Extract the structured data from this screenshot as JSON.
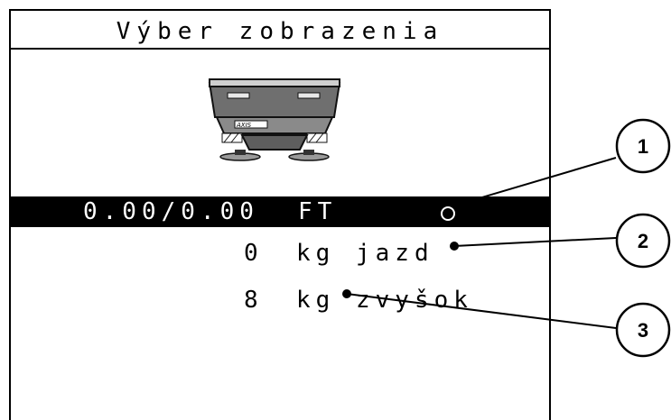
{
  "screen": {
    "title": "Výber zobrazenia",
    "device_icon": "spreader-machine-icon",
    "device_badge": "AXIS"
  },
  "rows": [
    {
      "value": "0.00/0.00",
      "unit": "FT",
      "selected": true
    },
    {
      "value": "0",
      "unit": "kg",
      "label": "jazd"
    },
    {
      "value": "8",
      "unit": "kg",
      "label": "zvyšok"
    }
  ],
  "callouts": [
    "1",
    "2",
    "3"
  ]
}
